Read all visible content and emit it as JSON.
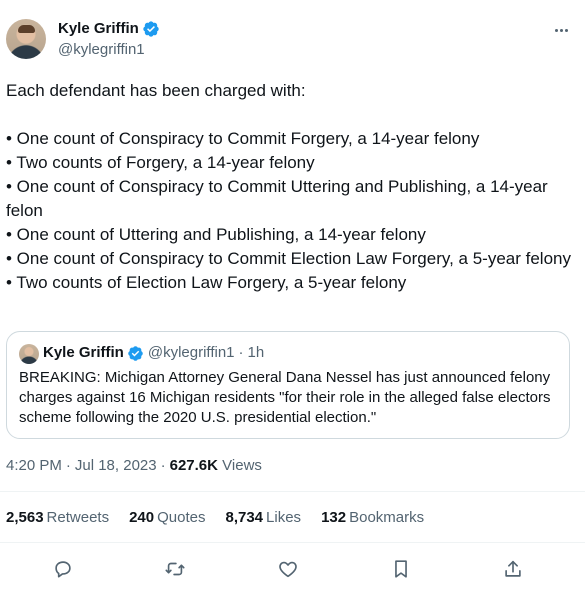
{
  "author": {
    "display_name": "Kyle Griffin",
    "handle": "@kylegriffin1",
    "verified_color": "#1d9bf0"
  },
  "menu": {
    "icon": "more-horizontal-icon"
  },
  "tweet": {
    "intro": "Each defendant has been charged with:",
    "bullets": [
      "• One count of Conspiracy to Commit Forgery, a 14-year felony",
      "• Two counts of Forgery, a 14-year felony",
      "• One count of Conspiracy to Commit Uttering and Publishing, a 14-year felon",
      "• One count of Uttering and Publishing, a 14-year felony",
      "• One count of Conspiracy to Commit Election Law Forgery, a 5-year felony",
      "• Two counts of Election Law Forgery, a 5-year felony"
    ]
  },
  "quoted": {
    "display_name": "Kyle Griffin",
    "handle": "@kylegriffin1",
    "dot": "·",
    "time": "1h",
    "text": "BREAKING: Michigan Attorney General Dana Nessel has just announced felony charges against 16 Michigan residents \"for their role in the alleged false electors scheme following the 2020 U.S. presidential election.\""
  },
  "meta": {
    "time": "4:20 PM",
    "sep": "·",
    "date": "Jul 18, 2023",
    "views_count": "627.6K",
    "views_label": "Views"
  },
  "stats": {
    "retweets": {
      "count": "2,563",
      "label": "Retweets"
    },
    "quotes": {
      "count": "240",
      "label": "Quotes"
    },
    "likes": {
      "count": "8,734",
      "label": "Likes"
    },
    "bookmarks": {
      "count": "132",
      "label": "Bookmarks"
    }
  },
  "actions": [
    "reply-icon",
    "retweet-icon",
    "like-icon",
    "bookmark-icon",
    "share-icon"
  ],
  "colors": {
    "text": "#0f1419",
    "secondary": "#536471",
    "border": "#cfd9de",
    "divider": "#eff3f4"
  }
}
